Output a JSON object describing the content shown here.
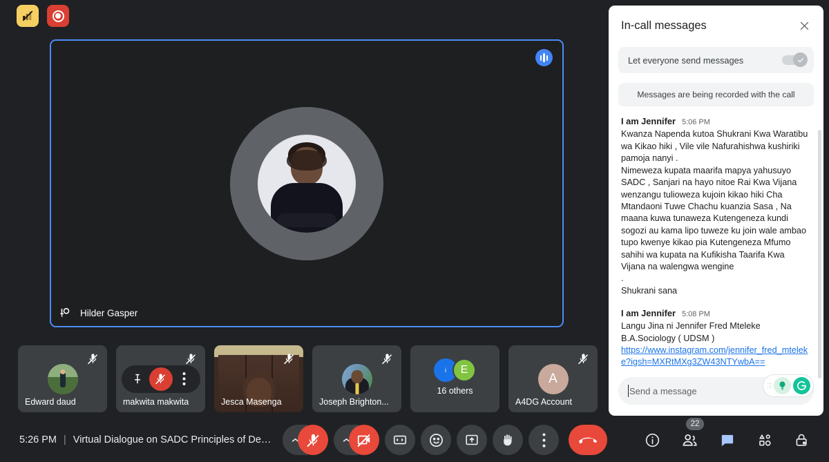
{
  "status_icons": {
    "network": {
      "name": "poor-network-icon",
      "color": "#f6cf63"
    },
    "recording": {
      "name": "recording-indicator",
      "color": "#d93f32"
    }
  },
  "spotlight": {
    "participant_name": "Hilder Gasper",
    "pinned": true,
    "speaking": true,
    "border_color": "#4b8cf7"
  },
  "thumbnails": [
    {
      "name": "Edward daud",
      "muted": true,
      "type": "avatar"
    },
    {
      "name": "makwita makwita",
      "muted": true,
      "type": "avatar",
      "hover_controls": [
        "pin",
        "mute",
        "more"
      ]
    },
    {
      "name": "Jesca Masenga",
      "muted": true,
      "type": "video"
    },
    {
      "name": "Joseph Brighton...",
      "muted": true,
      "type": "avatar"
    },
    {
      "name": "16 others",
      "muted": false,
      "type": "group",
      "group_initial": "E"
    },
    {
      "name": "A4DG Account",
      "muted": true,
      "type": "initial",
      "initial": "A"
    }
  ],
  "bottom_bar": {
    "time": "5:26 PM",
    "separator": "|",
    "meeting_title": "Virtual Dialogue on SADC Principles of De…",
    "controls": [
      {
        "name": "microphone-toggle",
        "state": "muted",
        "color": "#e8493a"
      },
      {
        "name": "camera-toggle",
        "state": "off",
        "color": "#e8493a"
      },
      {
        "name": "captions-toggle",
        "state": "off"
      },
      {
        "name": "emoji-reactions",
        "state": "off"
      },
      {
        "name": "present-screen",
        "state": "off"
      },
      {
        "name": "raise-hand",
        "state": "off"
      },
      {
        "name": "more-options",
        "state": "off"
      },
      {
        "name": "leave-call",
        "state": "active",
        "color": "#e8493a"
      }
    ],
    "right_controls": [
      {
        "name": "meeting-details",
        "badge": null
      },
      {
        "name": "people-panel",
        "badge": "22"
      },
      {
        "name": "chat-panel",
        "badge": null,
        "active": true,
        "color": "#a8c7fa"
      },
      {
        "name": "activities-panel",
        "badge": null
      },
      {
        "name": "host-controls",
        "badge": null
      }
    ]
  },
  "chat_panel": {
    "title": "In-call messages",
    "close_label": "✕",
    "toggle_label": "Let everyone send messages",
    "toggle_on": true,
    "recording_notice": "Messages are being recorded with the call",
    "messages": [
      {
        "author": "I am Jennifer",
        "time": "5:06 PM",
        "text": "Kwanza Napenda kutoa Shukrani Kwa Waratibu wa Kikao hiki , Vile vile Nafurahishwa kushiriki pamoja nanyi .\nNimeweza kupata maarifa mapya yahusuyo SADC , Sanjari na hayo nitoe Rai Kwa Vijana wenzangu tulioweza kujoin kikao hiki Cha Mtandaoni Tuwe Chachu kuanzia Sasa , Na maana kuwa tunaweza Kutengeneza kundi sogozi au kama lipo tuweze ku join wale ambao tupo kwenye kikao pia Kutengeneza Mfumo sahihi wa kupata na Kufikisha Taarifa Kwa Vijana na walengwa wengine\n.\nShukrani sana",
        "link": null
      },
      {
        "author": "I am Jennifer",
        "time": "5:08 PM",
        "text": "Langu Jina ni Jennifer Fred Mteleke\nB.A.Sociology ( UDSM )",
        "link": "https://www.instagram.com/jennifer_fred_mteleke?igsh=MXRtMXg3ZW43NTYwbA=="
      }
    ],
    "composer": {
      "placeholder": "Send a message",
      "value": "",
      "extension": {
        "name": "grammarly-widget",
        "accent": "#15c39a"
      }
    }
  }
}
